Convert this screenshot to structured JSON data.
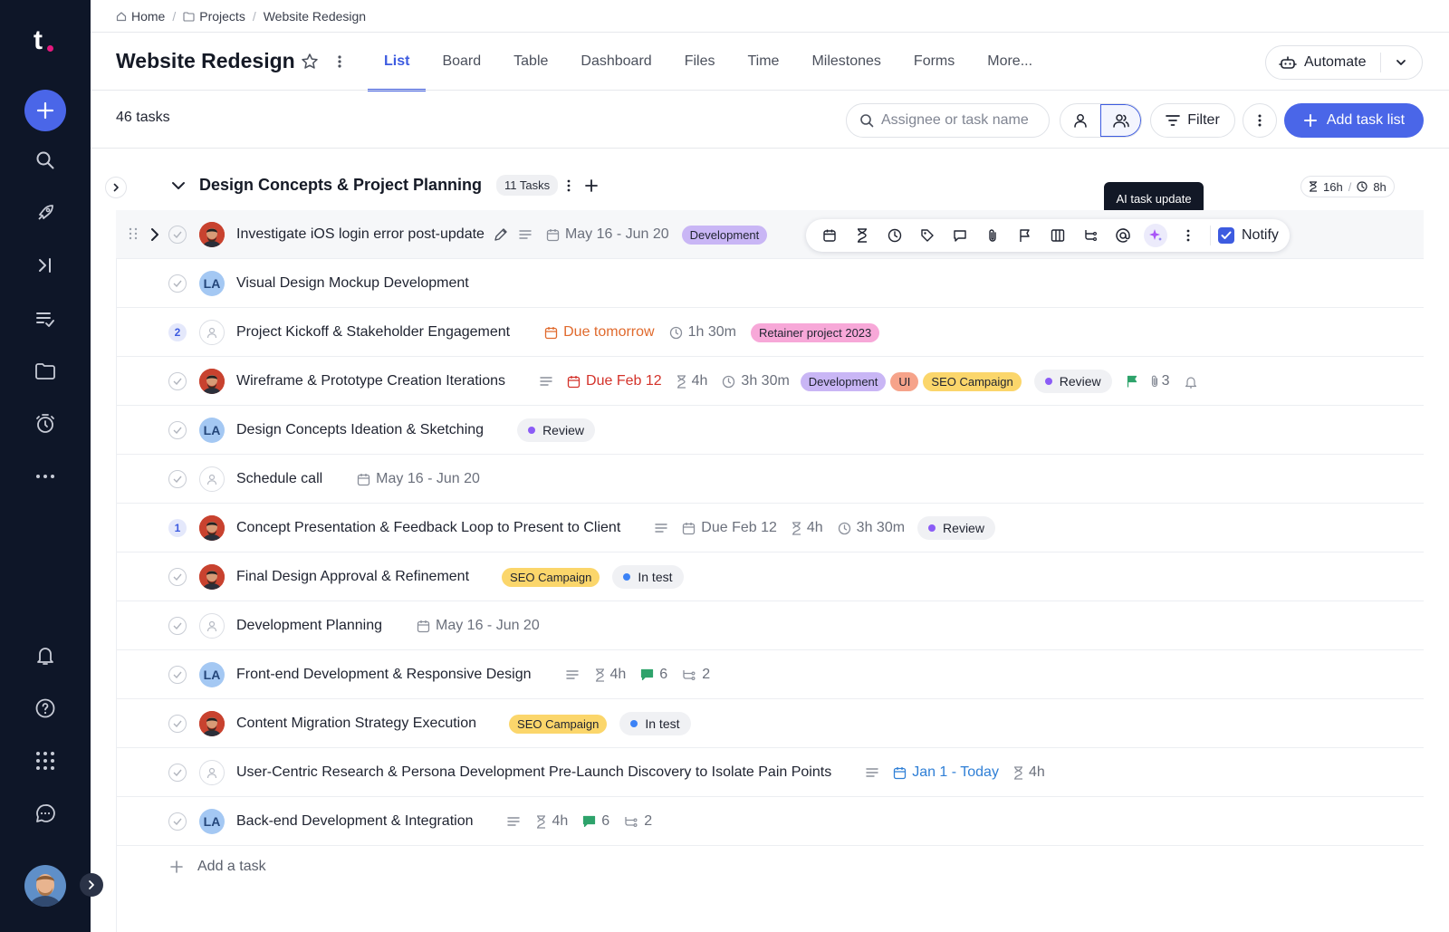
{
  "brand": {
    "logo": "t",
    "accent": "#4a66e8"
  },
  "sidebar": {
    "icons": [
      "plus-icon",
      "search-icon",
      "rocket-icon",
      "skip-icon",
      "checklist-icon",
      "folder-icon",
      "timer-icon",
      "more-icon",
      "bell-icon",
      "help-icon",
      "apps-grid-icon",
      "chat-icon"
    ]
  },
  "breadcrumb": {
    "home": "Home",
    "projects": "Projects",
    "current": "Website Redesign"
  },
  "header": {
    "title": "Website Redesign",
    "tabs": [
      "List",
      "Board",
      "Table",
      "Dashboard",
      "Files",
      "Time",
      "Milestones",
      "Forms",
      "More..."
    ],
    "active_tab": "List",
    "automate": "Automate"
  },
  "toolbar": {
    "task_count": "46 tasks",
    "search_placeholder": "Assignee or task name",
    "filter": "Filter",
    "add_task_list": "Add task list"
  },
  "group": {
    "name": "Design Concepts & Project Planning",
    "count": "11 Tasks",
    "estimate": "16h",
    "sep": "/",
    "logged": "8h",
    "tooltip": "AI task update"
  },
  "tasks": [
    {
      "name": "Investigate iOS login error post-update",
      "date": "May 16 - Jun 20",
      "tag": "Development"
    },
    {
      "name": "Visual Design Mockup Development",
      "avatar": "LA"
    },
    {
      "badge": "2",
      "name": "Project Kickoff & Stakeholder Engagement",
      "date": "Due tomorrow",
      "time": "1h 30m",
      "tag": "Retainer project 2023"
    },
    {
      "name": "Wireframe & Prototype Creation Iterations",
      "date": "Due Feb 12",
      "estimate": "4h",
      "time": "3h 30m",
      "tags": [
        "Development",
        "UI",
        "SEO Campaign"
      ],
      "status": "Review",
      "attachments": "3"
    },
    {
      "name": "Design Concepts Ideation & Sketching",
      "avatar": "LA",
      "status": "Review"
    },
    {
      "name": "Schedule call",
      "date": "May 16 - Jun 20"
    },
    {
      "badge": "1",
      "name": "Concept Presentation & Feedback Loop to Present to Client",
      "date": "Due Feb 12",
      "estimate": "4h",
      "time": "3h 30m",
      "status": "Review"
    },
    {
      "name": "Final Design Approval & Refinement",
      "tag": "SEO Campaign",
      "status": "In test"
    },
    {
      "name": "Development Planning",
      "date": "May 16 - Jun 20"
    },
    {
      "name": "Front-end Development & Responsive Design",
      "avatar": "LA",
      "estimate": "4h",
      "comments": "6",
      "subtasks": "2"
    },
    {
      "name": "Content Migration Strategy Execution",
      "tag": "SEO Campaign",
      "status": "In test"
    },
    {
      "name": "User-Centric Research & Persona Development Pre-Launch Discovery to Isolate Pain Points",
      "date": "Jan 1 - Today",
      "estimate": "4h"
    },
    {
      "name": "Back-end Development & Integration",
      "avatar": "LA",
      "estimate": "4h",
      "comments": "6",
      "subtasks": "2"
    }
  ],
  "row_actions": {
    "notify": "Notify"
  },
  "add_task": "Add a task",
  "colors": {
    "development": "#c9b6f5",
    "ui": "#f6a38a",
    "seo": "#fbd66b",
    "retainer": "#f7a8d8",
    "review": "#8b5cf6",
    "in_test": "#3b82f6"
  }
}
